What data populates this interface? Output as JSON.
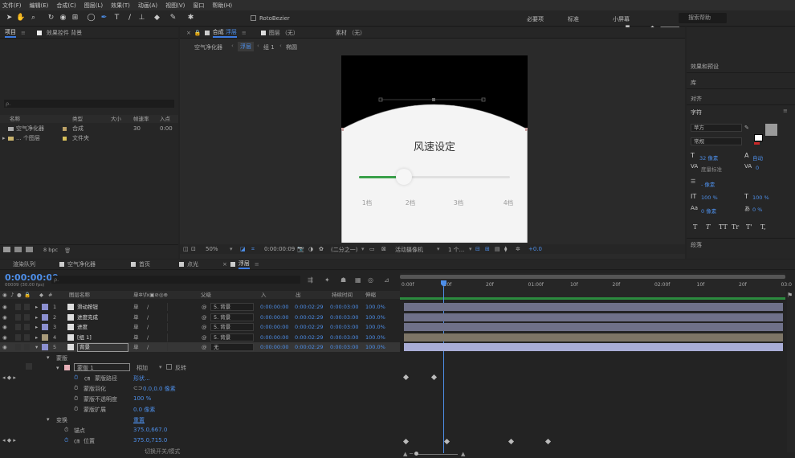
{
  "menu": [
    "文件(F)",
    "编辑(E)",
    "合成(C)",
    "图层(L)",
    "效果(T)",
    "动画(A)",
    "视图(V)",
    "窗口",
    "帮助(H)"
  ],
  "toolbar": {
    "roto": "RotoBezier",
    "ws": [
      "必要项",
      "标准",
      "小屏幕"
    ],
    "search": "搜索帮助"
  },
  "watermark": "虎课网",
  "project": {
    "tab": "项目",
    "fx_tab": "效果控件 背景",
    "search_ph": "ρ.",
    "cols": [
      "名称",
      "类型",
      "大小",
      "帧速率",
      "入点"
    ],
    "items": [
      {
        "name": "空气净化器",
        "type": "合成",
        "fps": "30",
        "in": "0:00"
      },
      {
        "name": "... 个图层",
        "type": "文件夹"
      }
    ],
    "bpc": "8 bpc"
  },
  "comp": {
    "tab_prefix": "合成",
    "tab_name": "浮层",
    "layer_tab": "图层 （无）",
    "footage_tab": "素材 （无）",
    "crumbs": [
      "空气净化器",
      "浮层",
      "组 1",
      "椭圆"
    ],
    "title": "风速设定",
    "progress": 0.25,
    "speed_labels": [
      "1档",
      "2档",
      "3档",
      "4档"
    ],
    "footer": {
      "zoom": "50%",
      "time": "0:00:00:09",
      "res": "(二分之一)",
      "cam": "活动摄像机",
      "view": "1 个...",
      "exp": "+0.0"
    }
  },
  "right": {
    "items": [
      "效果和预设",
      "库",
      "对齐"
    ],
    "char_title": "字符",
    "font": "苹方",
    "style": "常规",
    "size": "32 像素",
    "lead": "自动",
    "kern": "度量标准",
    "track": "0",
    "px": "- 像素",
    "vscale": "100 %",
    "hscale": "100 %",
    "base": "0 像素",
    "tsume": "0 %",
    "styles": [
      "T",
      "T",
      "TT",
      "Tr",
      "T'",
      "T,"
    ],
    "para": "段落"
  },
  "timeline": {
    "tabs": [
      "渲染队列",
      "空气净化器",
      "首页",
      "点光",
      "浮层"
    ],
    "time": "0:00:00:09",
    "fps": "00009 (30.00 fps)",
    "search_ph": "ρ.",
    "col_name": "图层名称",
    "col_parent": "父级",
    "col_in": "入",
    "col_out": "出",
    "col_dur": "持续时间",
    "col_str": "伸缩",
    "layers": [
      {
        "num": "1",
        "name": "滑动按钮",
        "parent": "5. 背景",
        "in": "0:00:00:00",
        "out": "0:00:02:29",
        "dur": "0:00:03:00",
        "str": "100.0%",
        "color": "#8b8fcf"
      },
      {
        "num": "2",
        "name": "进度完成",
        "parent": "5. 背景",
        "in": "0:00:00:00",
        "out": "0:00:02:29",
        "dur": "0:00:03:00",
        "str": "100.0%",
        "color": "#8b8fcf"
      },
      {
        "num": "3",
        "name": "进度",
        "parent": "5. 背景",
        "in": "0:00:00:00",
        "out": "0:00:02:29",
        "dur": "0:00:03:00",
        "str": "100.0%",
        "color": "#8b8fcf"
      },
      {
        "num": "4",
        "name": "[组 1]",
        "parent": "5. 背景",
        "in": "0:00:00:00",
        "out": "0:00:02:29",
        "dur": "0:00:03:00",
        "str": "100.0%",
        "color": "#a89a7a"
      },
      {
        "num": "5",
        "name": "背景",
        "parent": "无",
        "in": "0:00:00:00",
        "out": "0:00:02:29",
        "dur": "0:00:03:00",
        "str": "100.0%",
        "color": "#8b8fcf"
      }
    ],
    "props": {
      "masks": "蒙版",
      "mask1": "蒙版 1",
      "mode": "相加",
      "invert": "反转",
      "path": "蒙版路径",
      "path_val": "形状...",
      "feather": "蒙版羽化",
      "feather_val": "0.0,0.0 像素",
      "opacity": "蒙版不透明度",
      "opacity_val": "100 %",
      "expand": "蒙版扩展",
      "expand_val": "0.0 像素",
      "transform": "变换",
      "reset": "重置",
      "anchor": "锚点",
      "anchor_val": "375.0,667.0",
      "pos": "位置",
      "pos_val": "375.0,715.0"
    },
    "ruler": [
      "0:00f",
      "10f",
      "20f",
      "01:00f",
      "10f",
      "20f",
      "02:00f",
      "10f",
      "20f",
      "03:0"
    ],
    "bottom": "切换开关/模式"
  }
}
